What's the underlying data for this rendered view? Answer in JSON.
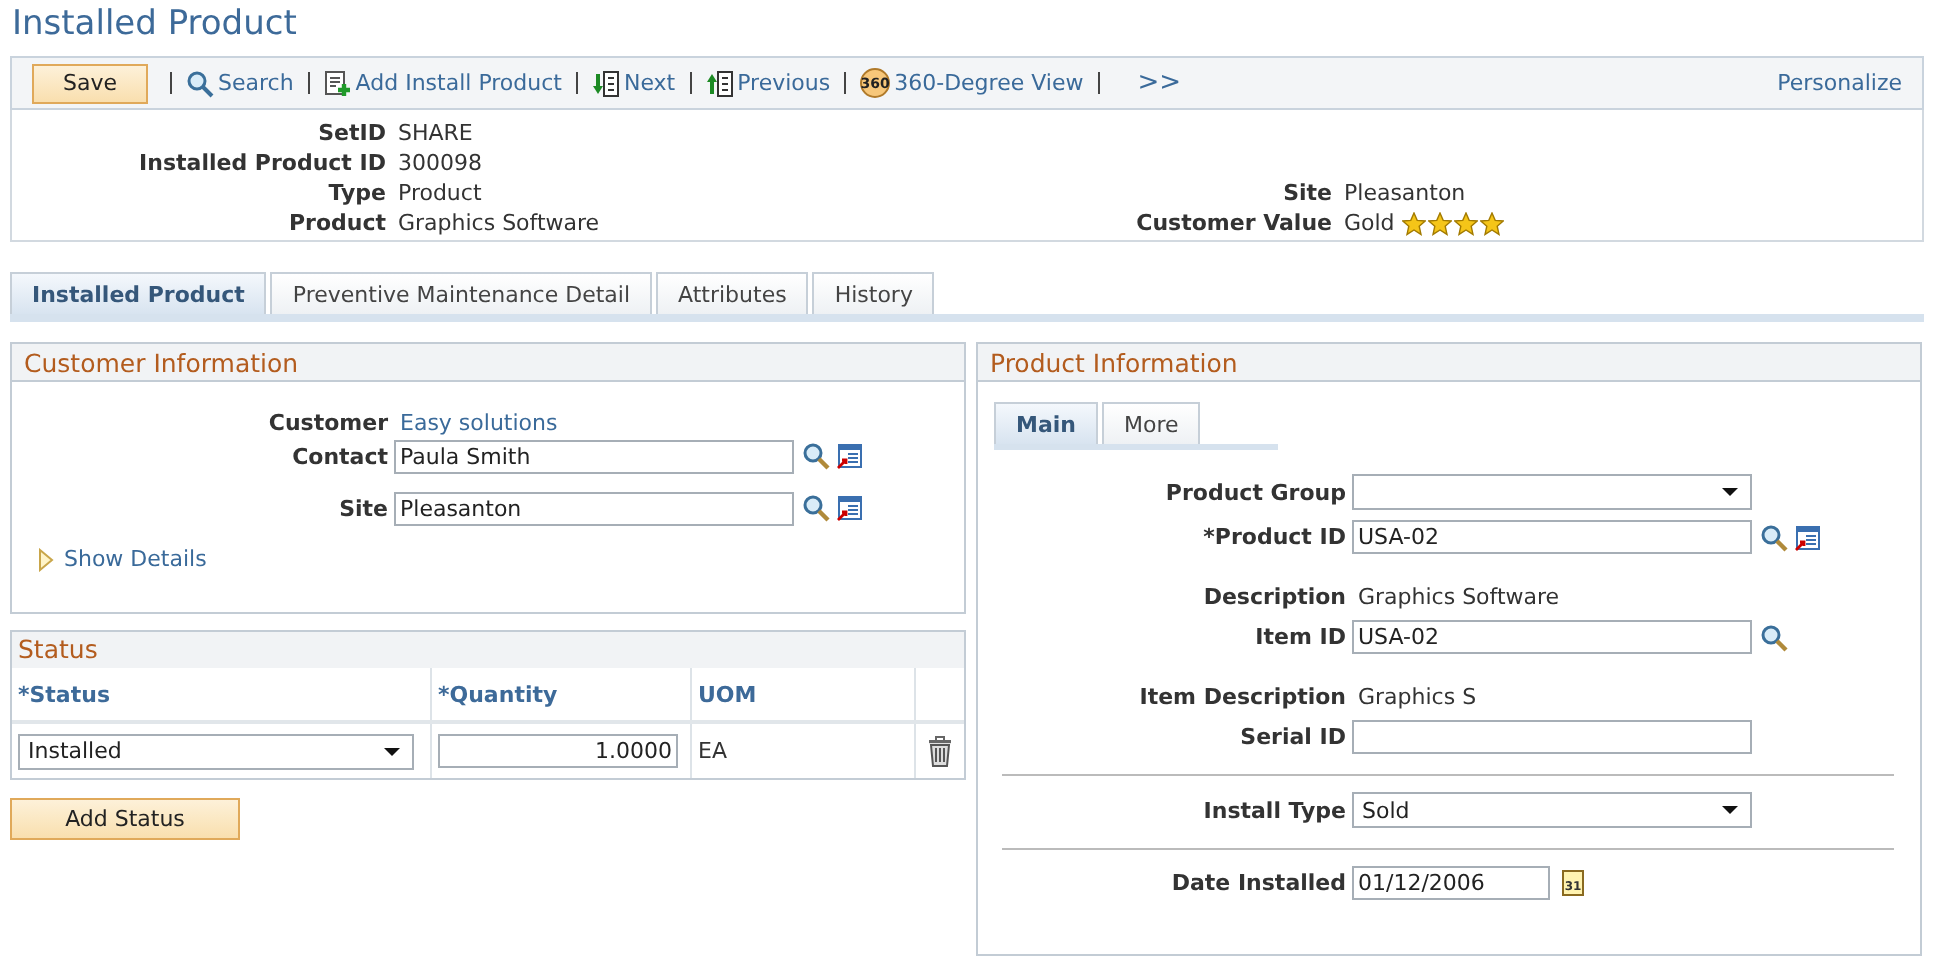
{
  "page_title": "Installed Product",
  "toolbar": {
    "save": "Save",
    "items": [
      {
        "kind": "search",
        "label": "Search"
      },
      {
        "kind": "add",
        "label": "Add Install Product"
      },
      {
        "kind": "next",
        "label": "Next"
      },
      {
        "kind": "previous",
        "label": "Previous"
      },
      {
        "kind": "view360",
        "label": "360-Degree View",
        "icon_text": "360"
      }
    ],
    "more": ">>",
    "personalize": "Personalize"
  },
  "header": [
    {
      "left": {
        "label": "SetID",
        "value": "SHARE"
      }
    },
    {
      "left": {
        "label": "Installed Product ID",
        "value": "300098"
      }
    },
    {
      "left": {
        "label": "Type",
        "value": "Product"
      },
      "right": {
        "label": "Site",
        "value": "Pleasanton"
      }
    },
    {
      "left": {
        "label": "Product",
        "value": "Graphics Software"
      },
      "right": {
        "label": "Customer Value",
        "value": "Gold",
        "stars": 4
      }
    }
  ],
  "tabs": [
    {
      "label": "Installed Product",
      "selected": true
    },
    {
      "label": "Preventive Maintenance Detail",
      "selected": false
    },
    {
      "label": "Attributes",
      "selected": false
    },
    {
      "label": "History",
      "selected": false
    }
  ],
  "customer_info": {
    "title": "Customer Information",
    "fields": [
      {
        "kind": "link",
        "label": "Customer",
        "value": "Easy solutions"
      },
      {
        "kind": "prompt",
        "label": "Contact",
        "value": "Paula Smith",
        "detail": true
      },
      {
        "kind": "prompt",
        "label": "Site",
        "value": "Pleasanton",
        "detail": true
      }
    ],
    "show_details": "Show Details"
  },
  "status": {
    "title": "Status",
    "columns": [
      "*Status",
      "*Quantity",
      "UOM"
    ],
    "rows": [
      {
        "status": "Installed",
        "quantity": "1.0000",
        "uom": "EA"
      }
    ],
    "add_button": "Add Status"
  },
  "product_info": {
    "title": "Product Information",
    "subtabs": [
      {
        "label": "Main",
        "selected": true
      },
      {
        "label": "More",
        "selected": false
      }
    ],
    "fields": [
      {
        "kind": "select",
        "label": "Product Group",
        "divider_before": false
      },
      {
        "kind": "prompt",
        "label": "*Product ID",
        "value": "USA-02",
        "detail": true,
        "divider_before": false
      },
      {
        "kind": "text",
        "label": "Description",
        "value": "Graphics Software",
        "divider_before": false
      },
      {
        "kind": "prompt",
        "label": "Item ID",
        "value": "USA-02",
        "detail": false,
        "divider_before": false
      },
      {
        "kind": "text",
        "label": "Item Description",
        "value": "Graphics S",
        "divider_before": false
      },
      {
        "kind": "input",
        "label": "Serial ID",
        "divider_before": false
      },
      {
        "kind": "select",
        "label": "Install Type",
        "value": "Sold",
        "divider_before": true
      },
      {
        "kind": "date",
        "label": "Date Installed",
        "value": "01/12/2006",
        "calendar_text": "31",
        "divider_before": true
      }
    ]
  }
}
